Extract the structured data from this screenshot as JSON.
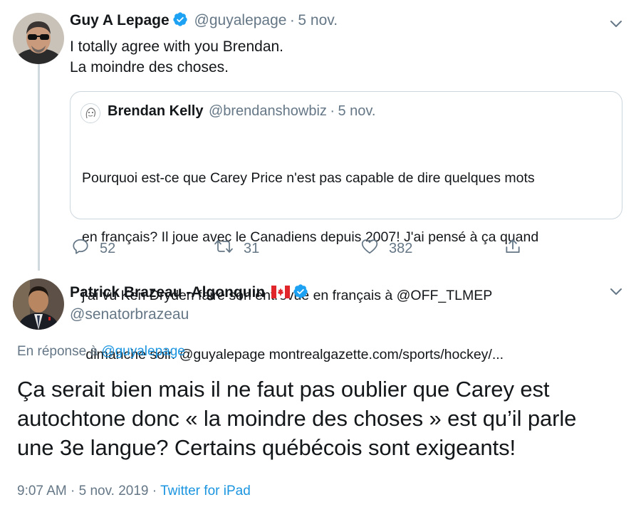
{
  "tweet1": {
    "name": "Guy A Lepage",
    "handle": "@guyalepage",
    "separator": "·",
    "date": "5 nov.",
    "text_line1": "I totally agree with you Brendan.",
    "text_line2": "La moindre des choses.",
    "quote": {
      "name": "Brendan Kelly",
      "handle": "@brendanshowbiz",
      "separator": "·",
      "date": "5 nov.",
      "line1": "Pourquoi est-ce que Carey Price n'est pas capable de dire quelques mots",
      "line2": "en français? Il joue avec le Canadiens depuis 2007! J'ai pensé à ça quand",
      "line3": "j'ai vu Ken Dryden faire son entrevue en français à @OFF_TLMEP",
      "line4": " dimanche soir. @guyalepage montrealgazette.com/sports/hockey/..."
    },
    "actions": {
      "replies": "52",
      "retweets": "31",
      "likes": "382"
    }
  },
  "tweet2": {
    "name": "Patrick Brazeau -Algonquin",
    "flag": "🇨🇦",
    "handle": "@senatorbrazeau",
    "reply_prefix": "En réponse à",
    "reply_handle": "@guyalepage",
    "text_line1": "Ça serait bien mais il ne faut pas oublier que Carey est",
    "text_line2": "autochtone donc « la moindre des choses » est qu’il parle",
    "text_line3": "une 3e langue? Certains québécois sont exigeants!",
    "time": "9:07 AM",
    "separator": "·",
    "date": "5 nov. 2019",
    "separator2": "·",
    "source": "Twitter for iPad"
  },
  "colors": {
    "accent": "#1b95e0",
    "secondary_text": "#657786",
    "verified": "#1da1f2",
    "border": "#ccd6dd"
  },
  "icons": [
    "verified-badge-icon",
    "chevron-down-icon",
    "reply-icon",
    "retweet-icon",
    "like-icon",
    "share-icon",
    "canada-flag-icon"
  ]
}
